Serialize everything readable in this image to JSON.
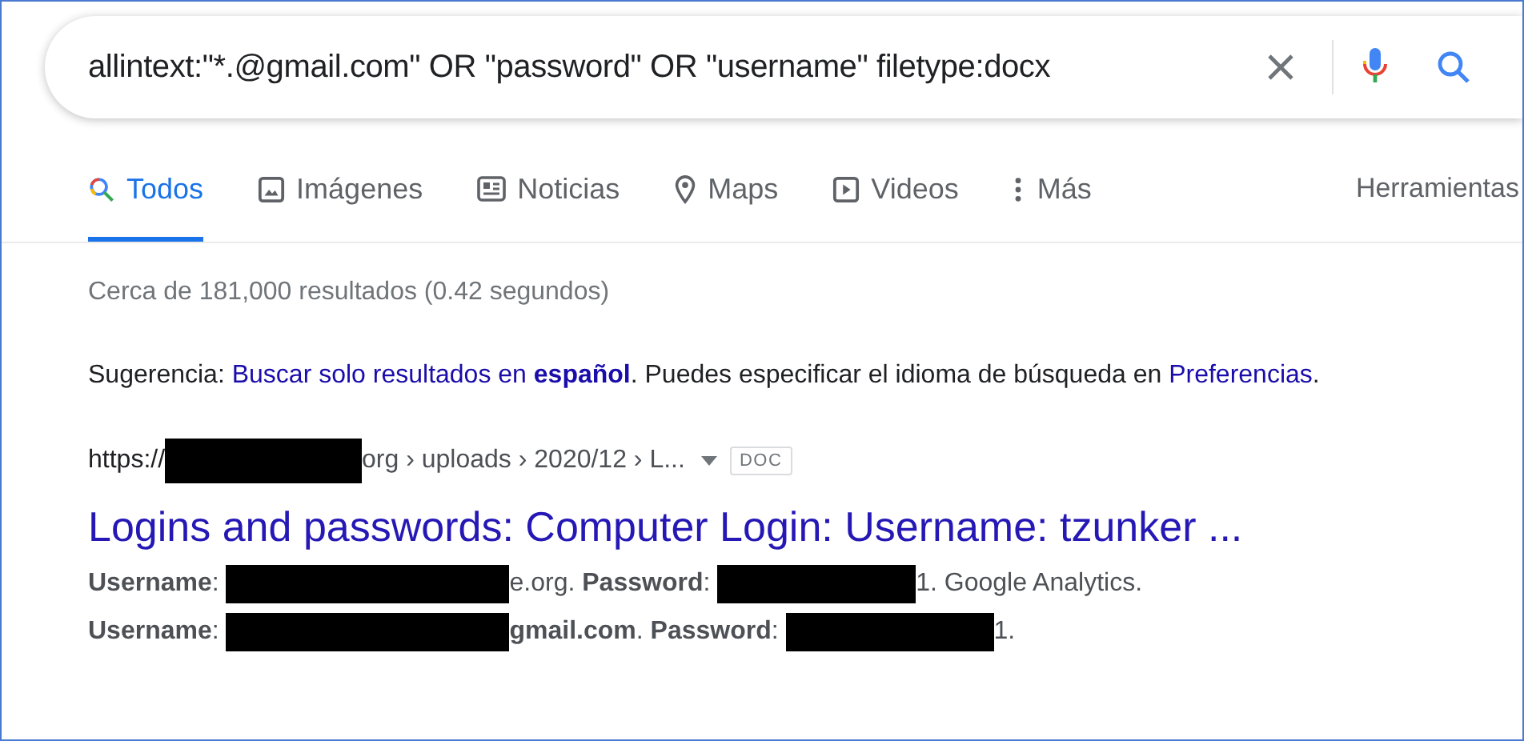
{
  "search": {
    "query": "allintext:\"*.@gmail.com\" OR \"password\" OR \"username\" filetype:docx"
  },
  "tabs": [
    {
      "label": "Todos",
      "kind": "all",
      "selected": true
    },
    {
      "label": "Imágenes",
      "kind": "images",
      "selected": false
    },
    {
      "label": "Noticias",
      "kind": "news",
      "selected": false
    },
    {
      "label": "Maps",
      "kind": "maps",
      "selected": false
    },
    {
      "label": "Videos",
      "kind": "videos",
      "selected": false
    },
    {
      "label": "Más",
      "kind": "more",
      "selected": false
    }
  ],
  "tools": "Herramientas",
  "stats": "Cerca de 181,000 resultados (0.42 segundos)",
  "suggestion": {
    "lead": "Sugerencia: ",
    "link": "Buscar solo resultados en **español**",
    "middle": ". Puedes especificar el idioma de búsqueda en ",
    "link2": "Preferencias",
    "end": "."
  },
  "result": {
    "url": [
      {
        "kind": "text",
        "text": "https://"
      },
      {
        "kind": "redacted"
      },
      {
        "kind": "text",
        "text": "org › uploads › 2020/12 › L..."
      }
    ],
    "badge": "DOC",
    "title": "Logins and passwords: Computer Login: Username: tzunker ...",
    "snippet": [
      [
        {
          "kind": "text",
          "text": "**Username**: "
        },
        {
          "kind": "redacted"
        },
        {
          "kind": "text",
          "text": "e.org. **Password**: "
        },
        {
          "kind": "redacted"
        },
        {
          "kind": "text",
          "text": "1. Google Analytics."
        }
      ],
      [
        {
          "kind": "text",
          "text": "**Username**: "
        },
        {
          "kind": "redacted"
        },
        {
          "kind": "text",
          "text": "**gmail.com**. **Password**: "
        },
        {
          "kind": "redacted"
        },
        {
          "kind": "text",
          "text": "1."
        }
      ]
    ]
  }
}
